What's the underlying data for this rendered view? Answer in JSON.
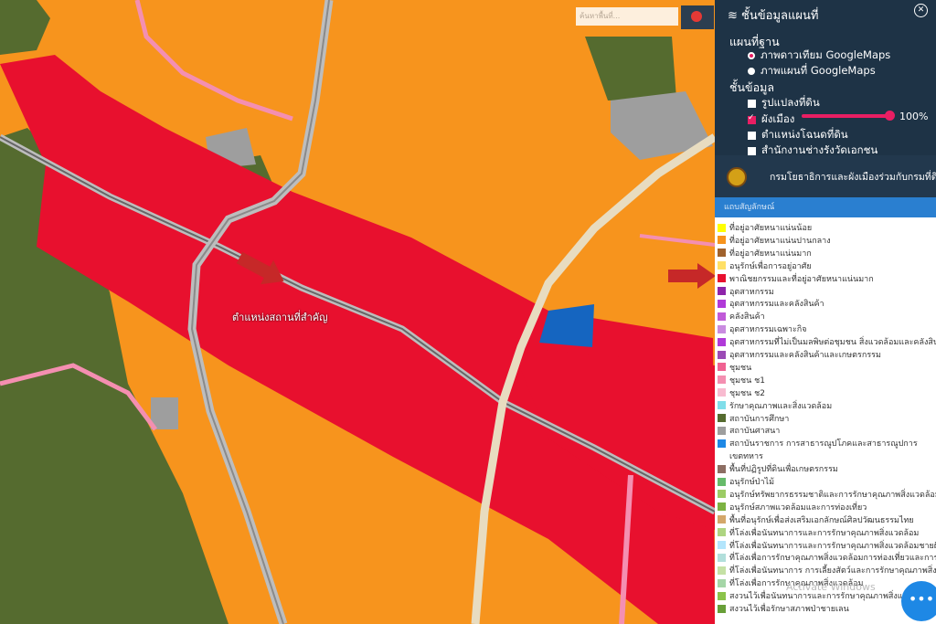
{
  "map": {
    "key_location_label": "ตำแหน่งสถานที่สำคัญ",
    "search_placeholder": "ค้นหาพื้นที่..."
  },
  "layers_panel": {
    "title": "ชั้นข้อมูลแผนที่",
    "base_map_heading": "แผนที่ฐาน",
    "base_options": [
      {
        "label": "ภาพดาวเทียม GoogleMaps",
        "selected": true
      },
      {
        "label": "ภาพแผนที่ GoogleMaps",
        "selected": false
      }
    ],
    "layers_heading": "ชั้นข้อมูล",
    "layers": [
      {
        "label": "รูปแปลงที่ดิน",
        "checked": false
      },
      {
        "label": "ผังเมือง",
        "checked": true,
        "opacity": "100%"
      },
      {
        "label": "ตำแหน่งโฉนดที่ดิน",
        "checked": false
      },
      {
        "label": "สำนักงานช่างรังวัดเอกชน",
        "checked": false
      }
    ]
  },
  "department": {
    "name": "กรมโยธาธิการและผังเมืองร่วมกับกรมที่ดิน"
  },
  "legend": {
    "heading": "แถบสัญลักษณ์",
    "items": [
      {
        "label": "ที่อยู่อาศัยหนาแน่นน้อย",
        "color": "#ffff00"
      },
      {
        "label": "ที่อยู่อาศัยหนาแน่นปานกลาง",
        "color": "#f7941d"
      },
      {
        "label": "ที่อยู่อาศัยหนาแน่นมาก",
        "color": "#a0622d"
      },
      {
        "label": "อนุรักษ์เพื่อการอยู่อาศัย",
        "color": "#ffe066"
      },
      {
        "label": "พาณิชยกรรมและที่อยู่อาศัยหนาแน่นมาก",
        "color": "#e8102e"
      },
      {
        "label": "อุตสาหกรรม",
        "color": "#8e24aa"
      },
      {
        "label": "อุตสาหกรรมและคลังสินค้า",
        "color": "#b03ad8"
      },
      {
        "label": "คลังสินค้า",
        "color": "#c05ad8"
      },
      {
        "label": "อุตสาหกรรมเฉพาะกิจ",
        "color": "#c98be0"
      },
      {
        "label": "อุตสาหกรรมที่ไม่เป็นมลพิษต่อชุมชน สิ่งแวดล้อมและคลังสินค้า",
        "color": "#b03ad8"
      },
      {
        "label": "อุตสาหกรรมและคลังสินค้าและเกษตรกรรม",
        "color": "#9b4bb5"
      },
      {
        "label": "ชุมชน",
        "color": "#f06292"
      },
      {
        "label": "ชุมชน ช1",
        "color": "#f48fb1"
      },
      {
        "label": "ชุมชน ช2",
        "color": "#f8bbd0"
      },
      {
        "label": "รักษาคุณภาพและสิ่งแวดล้อม",
        "color": "#80deea"
      },
      {
        "label": "สถาบันการศึกษา",
        "color": "#556b2f"
      },
      {
        "label": "สถาบันศาสนา",
        "color": "#9e9e9e"
      },
      {
        "label": "สถาบันราชการ การสาธารณูปโภคและสาธารณูปการ",
        "color": "#1e88e5"
      },
      {
        "label": "เขตทหาร",
        "color": ""
      },
      {
        "label": "พื้นที่ปฏิรูปที่ดินเพื่อเกษตรกรรม",
        "color": "#8d6e63"
      },
      {
        "label": "อนุรักษ์ป่าไม้",
        "color": "#66bb6a"
      },
      {
        "label": "อนุรักษ์ทรัพยากรธรรมชาติและการรักษาคุณภาพสิ่งแวดล้อม",
        "color": "#9ccc65"
      },
      {
        "label": "อนุรักษ์สภาพแวดล้อมและการท่องเที่ยว",
        "color": "#7cb342"
      },
      {
        "label": "พื้นที่อนุรักษ์เพื่อส่งเสริมเอกลักษณ์ศิลปวัฒนธรรมไทย",
        "color": "#d4a76a"
      },
      {
        "label": "ที่โล่งเพื่อนันทนาการและการรักษาคุณภาพสิ่งแวดล้อม",
        "color": "#aed581"
      },
      {
        "label": "ที่โล่งเพื่อนันทนาการและการรักษาคุณภาพสิ่งแวดล้อมชายฝั่ง",
        "color": "#b3e5fc"
      },
      {
        "label": "ที่โล่งเพื่อการรักษาคุณภาพสิ่งแวดล้อมการท่องเที่ยวและการป",
        "color": "#b2dfdb"
      },
      {
        "label": "ที่โล่งเพื่อนันทนาการ การเลี้ยงสัตว์และการรักษาคุณภาพสิ่งแว",
        "color": "#c5e1a5"
      },
      {
        "label": "ที่โล่งเพื่อการรักษาคุณภาพสิ่งแวดล้อม",
        "color": "#a5d6a7"
      },
      {
        "label": "สงวนไว้เพื่อนันทนาการและการรักษาคุณภาพสิ่งแวดล้อม",
        "color": "#8bc34a"
      },
      {
        "label": "สงวนไว้เพื่อรักษาสภาพป่าชายเลน",
        "color": "#689f38"
      }
    ]
  },
  "fab_label": "•••",
  "watermark": "Activate Windows"
}
